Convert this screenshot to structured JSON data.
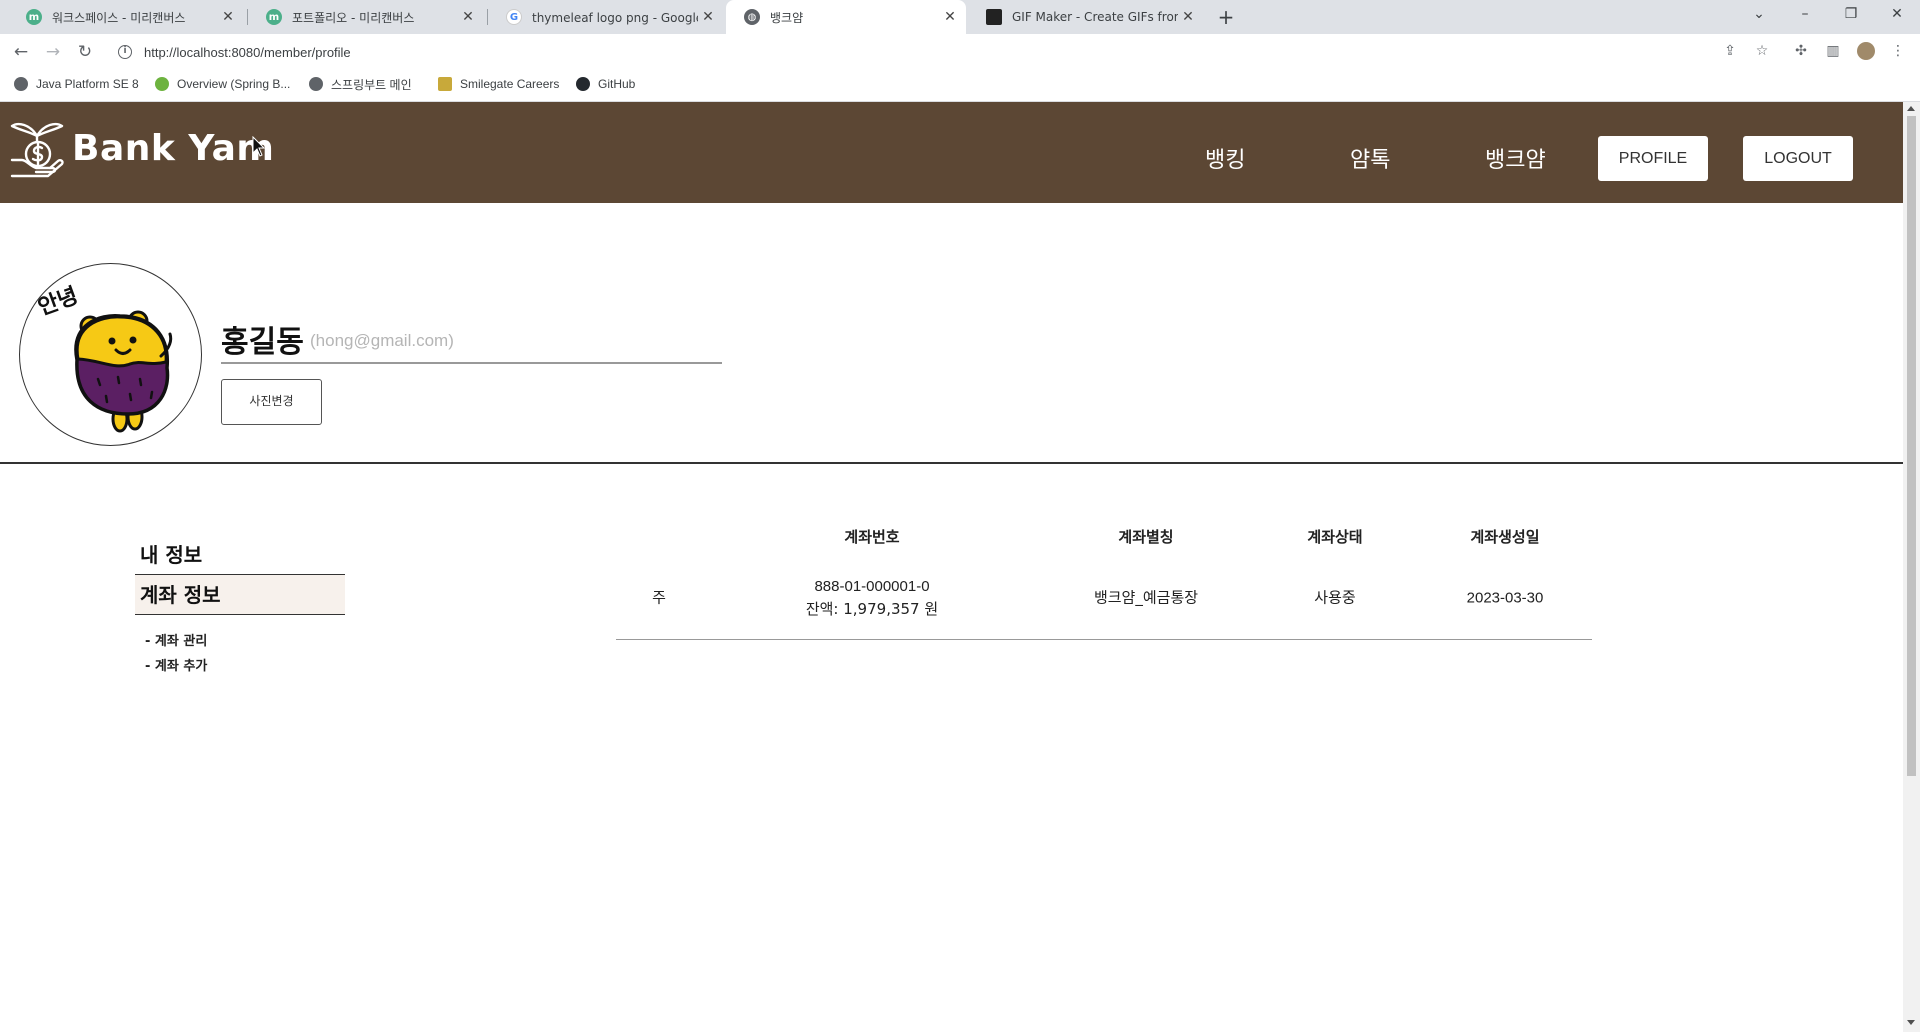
{
  "browser": {
    "tabs": [
      {
        "title": "워크스페이스 - 미리캔버스",
        "favicon": "miricanvas-icon"
      },
      {
        "title": "포트폴리오 - 미리캔버스",
        "favicon": "miricanvas-icon"
      },
      {
        "title": "thymeleaf logo png - Google 검",
        "favicon": "google-icon"
      },
      {
        "title": "뱅크얌",
        "favicon": "globe-icon",
        "active": true
      },
      {
        "title": "GIF Maker - Create GIFs from V",
        "favicon": "gif-maker-icon"
      }
    ],
    "url": "http://localhost:8080/member/profile",
    "bookmarks": [
      {
        "label": "Java Platform SE 8"
      },
      {
        "label": "Overview (Spring B..."
      },
      {
        "label": "스프링부트 메인"
      },
      {
        "label": "Smilegate Careers"
      },
      {
        "label": "GitHub"
      }
    ]
  },
  "header": {
    "brand": "Bank Yam",
    "nav": [
      "뱅킹",
      "얌톡",
      "뱅크얌"
    ],
    "profile_button": "PROFILE",
    "logout_button": "LOGOUT"
  },
  "profile": {
    "name": "홍길동",
    "email": "(hong@gmail.com)",
    "change_photo_button": "사진변경",
    "avatar_text": "안녕"
  },
  "side_menu": {
    "my_info": "내 정보",
    "account_info": "계좌 정보",
    "sub_items": [
      "- 계좌 관리",
      "- 계좌 추가"
    ]
  },
  "accounts": {
    "columns": [
      "계좌번호",
      "계좌별칭",
      "계좌상태",
      "계좌생성일"
    ],
    "rows": [
      {
        "type": "주",
        "number": "888-01-000001-0",
        "balance": "잔액: 1,979,357 원",
        "alias": "뱅크얌_예금통장",
        "status": "사용중",
        "created": "2023-03-30"
      }
    ]
  },
  "colors": {
    "header_bg": "#5c4734",
    "active_menu_bg": "#f7f1ec",
    "avatar_purple": "#5b1f63",
    "avatar_yellow": "#f6c915"
  }
}
